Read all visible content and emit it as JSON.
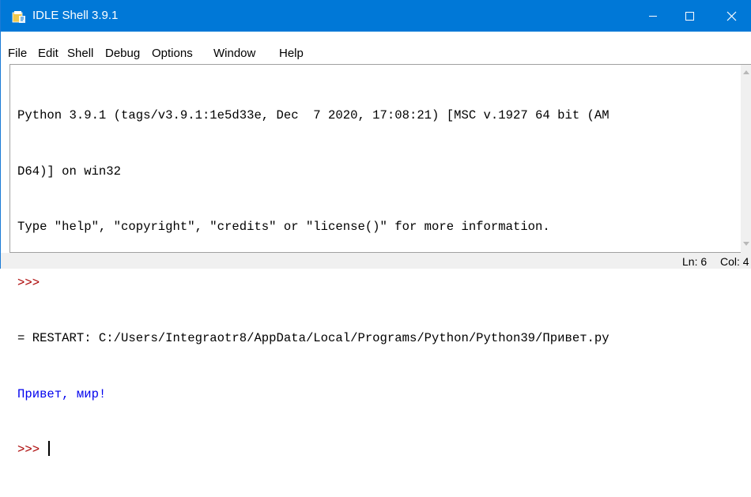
{
  "window": {
    "title": "IDLE Shell 3.9.1",
    "controls": {
      "minimize": "—",
      "maximize": "☐",
      "close": "✕"
    }
  },
  "menu": [
    "File",
    "Edit",
    "Shell",
    "Debug",
    "Options",
    "Window",
    "Help"
  ],
  "shell": {
    "banner_line1": "Python 3.9.1 (tags/v3.9.1:1e5d33e, Dec  7 2020, 17:08:21) [MSC v.1927 64 bit (AM",
    "banner_line2": "D64)] on win32",
    "banner_line3": "Type \"help\", \"copyright\", \"credits\" or \"license()\" for more information.",
    "prompt": ">>>",
    "restart_line": "= RESTART: C:/Users/Integraotr8/AppData/Local/Programs/Python/Python39/Привет.py",
    "output": "Привет, мир!",
    "prompt_active": ">>>"
  },
  "status": {
    "line": "Ln: 6",
    "col": "Col: 4"
  },
  "colors": {
    "titlebar": "#0078d7",
    "prompt": "#aa0000",
    "stdout": "#0000ee",
    "statusbar": "#f0f0f0"
  }
}
